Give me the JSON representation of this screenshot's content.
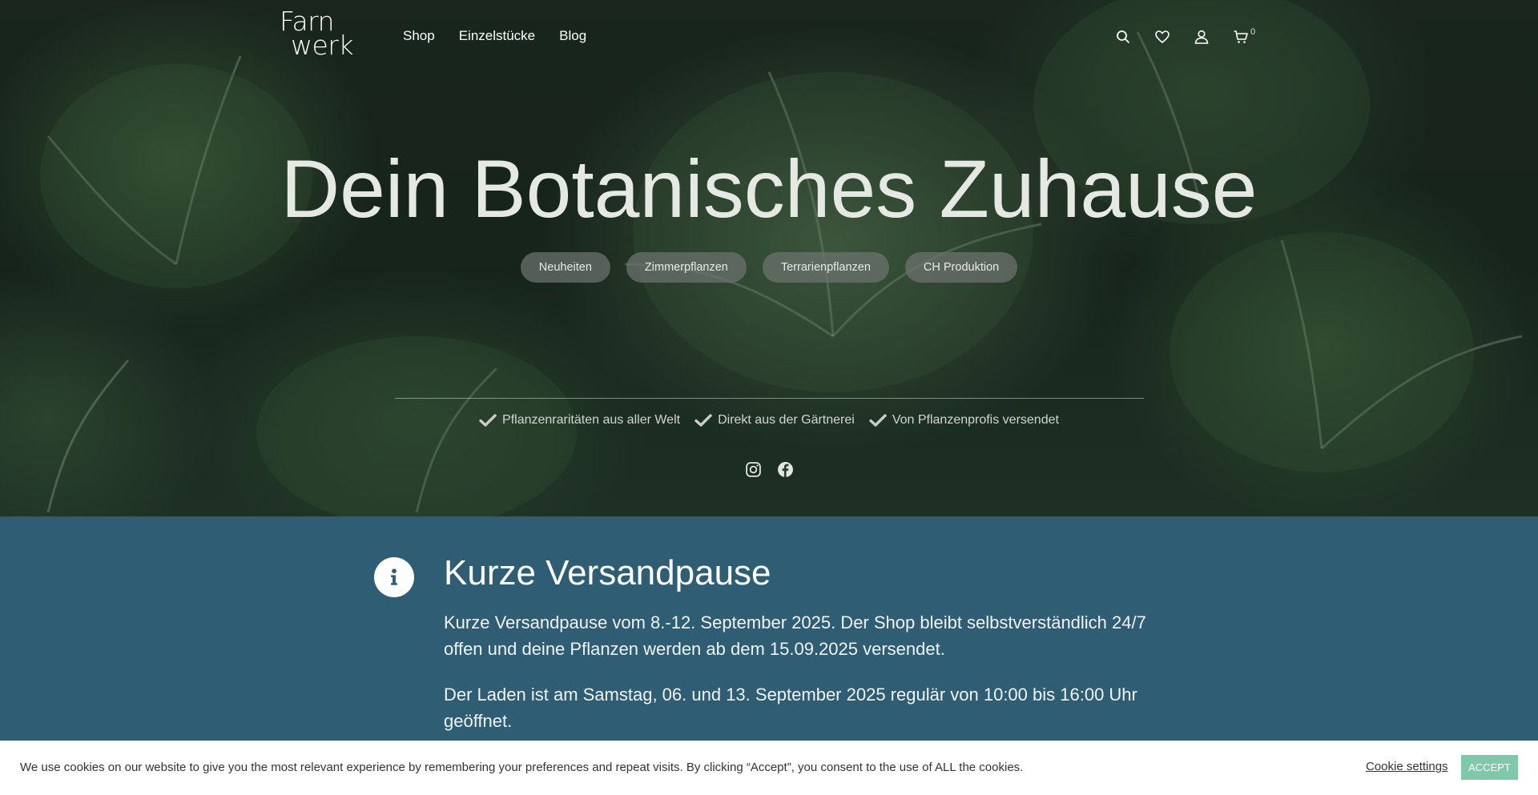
{
  "brand": {
    "logo_line1": "Farn",
    "logo_line2": "werk"
  },
  "nav": {
    "items": [
      {
        "label": "Shop"
      },
      {
        "label": "Einzelstücke"
      },
      {
        "label": "Blog"
      }
    ]
  },
  "header_tools": {
    "cart_count": "0",
    "icons": [
      "search-icon",
      "heart-icon",
      "user-icon",
      "cart-icon"
    ]
  },
  "hero": {
    "title": "Dein Botanisches Zuhause",
    "pills": [
      "Neuheiten",
      "Zimmerpflanzen",
      "Terrarienpflanzen",
      "CH Produktion"
    ],
    "usps": [
      "Pflanzenraritäten aus aller Welt",
      "Direkt aus der Gärtnerei",
      "Von Pflanzenprofis versendet"
    ],
    "social": [
      "instagram-icon",
      "facebook-icon"
    ]
  },
  "notice": {
    "title": "Kurze Versandpause",
    "paragraph1": "Kurze Versandpause vom 8.-12. September 2025. Der Shop bleibt selbstverständlich 24/7 offen und deine Pflanzen werden ab dem 15.09.2025 versendet.",
    "paragraph2": "Der Laden ist am Samstag, 06. und 13. September 2025 regulär von 10:00 bis 16:00 Uhr geöffnet."
  },
  "cookie": {
    "text": "We use cookies on our website to give you the most relevant experience by remembering your preferences and repeat visits. By clicking “Accept”, you consent to the use of ALL the cookies.",
    "settings_label": "Cookie settings",
    "accept_label": "ACCEPT"
  },
  "colors": {
    "notice_bg": "#2f5e74",
    "accept_bg": "#7fc8a9",
    "pill_bg": "#6e7370"
  }
}
